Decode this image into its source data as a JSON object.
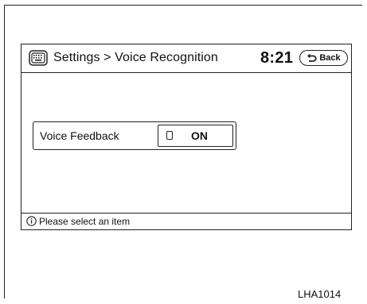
{
  "header": {
    "menu_icon": "keyboard-menu-icon",
    "title": "Settings > Voice Recognition",
    "clock": "8:21",
    "back_label": "Back",
    "back_icon": "back-arrow-icon"
  },
  "settings": {
    "items": [
      {
        "label": "Voice Feedback",
        "value": "ON",
        "indicator_icon": "toggle-indicator-icon"
      }
    ]
  },
  "status_bar": {
    "icon": "info-icon",
    "message": "Please select an item"
  },
  "figure_code": "LHA1014"
}
